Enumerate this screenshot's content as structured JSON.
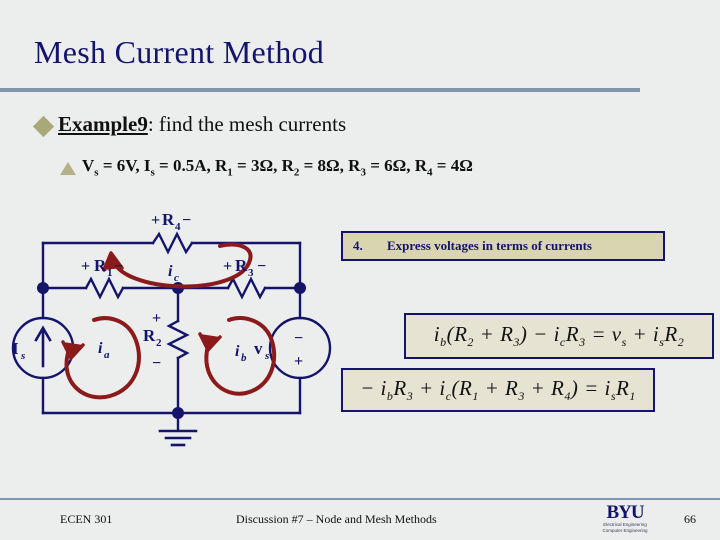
{
  "slide": {
    "title": "Mesh Current Method",
    "background_color": "#eceded",
    "title_color": "#14146b",
    "rule_color": "#8195ad",
    "accent_color": "#a8a878"
  },
  "bullets": {
    "level1": {
      "bullet_glyph": "diamond",
      "label": "Example9",
      "rest": ": find the mesh currents"
    },
    "level2": {
      "bullet_glyph": "chevron-up",
      "text": "Vs = 6V, Is = 0.5A, R1 = 3Ω, R2 = 8Ω, R3 = 6Ω, R4 = 4Ω",
      "values": {
        "Vs": "6V",
        "Is": "0.5A",
        "R1": "3Ω",
        "R2": "8Ω",
        "R3": "6Ω",
        "R4": "4Ω"
      }
    }
  },
  "circuit": {
    "wire_color": "#14146b",
    "loop_color": "#8b1a1a",
    "sources": [
      {
        "name": "Is",
        "label": "I",
        "sub": "s",
        "type": "current-source",
        "arrow": "up"
      },
      {
        "name": "vs",
        "label": "v",
        "sub": "s",
        "type": "voltage-source",
        "top_sign": "−",
        "bottom_sign": "+"
      }
    ],
    "resistors": [
      {
        "name": "R4",
        "label": "R",
        "sub": "4",
        "left_sign": "+",
        "right_sign": "−",
        "orientation": "horizontal"
      },
      {
        "name": "R1",
        "label": "R",
        "sub": "1",
        "left_sign": "+",
        "right_sign": "−",
        "orientation": "horizontal"
      },
      {
        "name": "R3",
        "label": "R",
        "sub": "3",
        "left_sign": "+",
        "right_sign": "−",
        "orientation": "horizontal"
      },
      {
        "name": "R2",
        "label": "R",
        "sub": "2",
        "top_sign": "+",
        "bottom_sign": "−",
        "orientation": "vertical"
      }
    ],
    "mesh_currents": [
      {
        "name": "ia",
        "label": "i",
        "sub": "a",
        "direction": "clockwise"
      },
      {
        "name": "ib",
        "label": "i",
        "sub": "b",
        "direction": "clockwise"
      },
      {
        "name": "ic",
        "label": "i",
        "sub": "c",
        "direction": "counterclockwise"
      }
    ],
    "ground": "ground-symbol"
  },
  "step_box": {
    "number": "4.",
    "text": "Express voltages in terms of currents",
    "background": "#d9d5b0",
    "border": "#14146b"
  },
  "equations": [
    {
      "name": "mesh-b-equation",
      "parts": [
        {
          "t": "i",
          "sub": "b"
        },
        {
          "t": "(R"
        },
        {
          "t": "",
          "sub": "2"
        },
        {
          "t": " + R"
        },
        {
          "t": "",
          "sub": "3"
        },
        {
          "t": ") − i"
        },
        {
          "t": "",
          "sub": "c"
        },
        {
          "t": "R"
        },
        {
          "t": "",
          "sub": "3"
        },
        {
          "t": " = v"
        },
        {
          "t": "",
          "sub": "s"
        },
        {
          "t": " + i"
        },
        {
          "t": "",
          "sub": "s"
        },
        {
          "t": "R"
        },
        {
          "t": "",
          "sub": "2"
        }
      ],
      "plain": "ib(R2 + R3) − icR3 = vs + isR2"
    },
    {
      "name": "mesh-c-equation",
      "parts": [
        {
          "t": "− i",
          "sub": "b"
        },
        {
          "t": "R"
        },
        {
          "t": "",
          "sub": "3"
        },
        {
          "t": " + i"
        },
        {
          "t": "",
          "sub": "c"
        },
        {
          "t": "(R"
        },
        {
          "t": "",
          "sub": "1"
        },
        {
          "t": " + R"
        },
        {
          "t": "",
          "sub": "3"
        },
        {
          "t": " + R"
        },
        {
          "t": "",
          "sub": "4"
        },
        {
          "t": ") = i"
        },
        {
          "t": "",
          "sub": "s"
        },
        {
          "t": "R"
        },
        {
          "t": "",
          "sub": "1"
        }
      ],
      "plain": "− ibR3 + ic(R1 + R3 + R4) = isR1"
    }
  ],
  "footer": {
    "course": "ECEN 301",
    "center": "Discussion #7 – Node and Mesh Methods",
    "page": "66",
    "logo": {
      "name": "BYU",
      "line1": "Electrical Engineering",
      "line2": "Computer Engineering"
    }
  }
}
